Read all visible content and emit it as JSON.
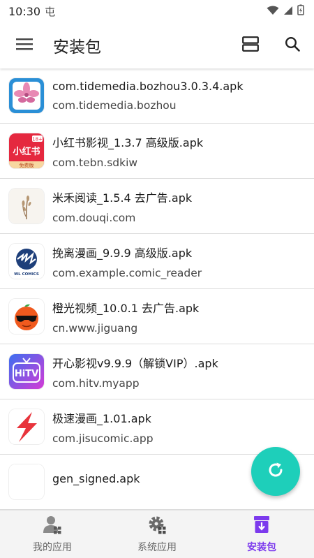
{
  "status_bar": {
    "time": "10:30",
    "carrier_glyph": "屯"
  },
  "app_bar": {
    "title": "安装包",
    "menu_icon": "menu-icon",
    "view_icon": "view-toggle-icon",
    "search_icon": "search-icon"
  },
  "apps": [
    {
      "title": "com.tidemedia.bozhou3.0.3.4.apk",
      "package": "com.tidemedia.bozhou",
      "icon": "flower-icon"
    },
    {
      "title": "小红书影视_1.3.7 高级版.apk",
      "package": "com.tebn.sdkiw",
      "icon": "xiaohongshu-icon",
      "icon_text": "小红书",
      "icon_badge": "18+",
      "icon_banner": "免费版"
    },
    {
      "title": "米禾阅读_1.5.4 去广告.apk",
      "package": "com.douqi.com",
      "icon": "wheat-icon"
    },
    {
      "title": "挽离漫画_9.9.9 高级版.apk",
      "package": "com.example.comic_reader",
      "icon": "comic-logo-icon",
      "icon_text": "WL COMICS"
    },
    {
      "title": "橙光视频_10.0.1 去广告.apk",
      "package": "cn.www.jiguang",
      "icon": "orange-sunglasses-icon"
    },
    {
      "title": "开心影视v9.9.9（解锁VIP）.apk",
      "package": "com.hitv.myapp",
      "icon": "hitv-icon",
      "icon_text": "HiTV"
    },
    {
      "title": "极速漫画_1.01.apk",
      "package": "com.jisucomic.app",
      "icon": "lightning-icon"
    },
    {
      "title": "gen_signed.apk",
      "package": "",
      "icon": "blank-icon"
    }
  ],
  "fab": {
    "icon": "refresh-icon"
  },
  "bottom_nav": [
    {
      "label": "我的应用",
      "icon": "user-apps-icon",
      "active": false
    },
    {
      "label": "系统应用",
      "icon": "system-gear-icon",
      "active": false
    },
    {
      "label": "安装包",
      "icon": "package-box-icon",
      "active": true
    }
  ],
  "colors": {
    "accent": "#1ecfba",
    "active_tab": "#7c3aed",
    "divider": "#dcdcdc"
  }
}
